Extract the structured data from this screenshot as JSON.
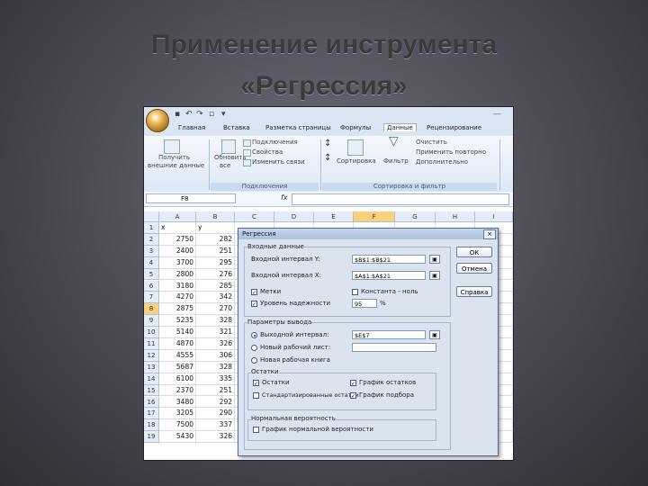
{
  "slide": {
    "title_line1": "Применение инструмента",
    "title_line2": "«Регрессия»"
  },
  "excel": {
    "tabs": [
      "Главная",
      "Вставка",
      "Разметка страницы",
      "Формулы",
      "Данные",
      "Рецензирование"
    ],
    "active_tab": "Данные",
    "ribbon": {
      "get_external_1": "Получить",
      "get_external_2": "внешние данные",
      "refresh_1": "Обновить",
      "refresh_2": "все",
      "connections": "Подключения",
      "properties": "Свойства",
      "edit_links": "Изменить связи",
      "sort": "Сортировка",
      "filter": "Фильтр",
      "clear": "Очистить",
      "reapply": "Применить повторно",
      "advanced": "Дополнительно",
      "group_connections": "Подключения",
      "group_sort_filter": "Сортировка и фильтр"
    },
    "name_box": "F8",
    "fx": "fx",
    "columns": [
      "A",
      "B",
      "C",
      "D",
      "E",
      "F",
      "G",
      "H",
      "I"
    ],
    "rows": [
      [
        "x",
        "y"
      ],
      [
        "2750",
        "282"
      ],
      [
        "2400",
        "251"
      ],
      [
        "3700",
        "295"
      ],
      [
        "2800",
        "276"
      ],
      [
        "3180",
        "285"
      ],
      [
        "4270",
        "342"
      ],
      [
        "2875",
        "270"
      ],
      [
        "5235",
        "328"
      ],
      [
        "5140",
        "321"
      ],
      [
        "4870",
        "326"
      ],
      [
        "4555",
        "306"
      ],
      [
        "5687",
        "328"
      ],
      [
        "6100",
        "335"
      ],
      [
        "2370",
        "251"
      ],
      [
        "3480",
        "292"
      ],
      [
        "3205",
        "290"
      ],
      [
        "7500",
        "337"
      ],
      [
        "5430",
        "326"
      ]
    ]
  },
  "dialog": {
    "title": "Регрессия",
    "close": "×",
    "input_section": "Входные данные",
    "input_y_label": "Входной интервал Y:",
    "input_y_value": "$B$1:$B$21",
    "input_x_label": "Входной интервал X:",
    "input_x_value": "$A$1:$A$21",
    "labels_cb": "Метки",
    "constant_zero_cb": "Константа - ноль",
    "confidence_cb": "Уровень надежности",
    "confidence_value": "95",
    "percent": "%",
    "output_section": "Параметры вывода",
    "output_range": "Выходной интервал:",
    "output_range_value": "$E$7",
    "new_sheet": "Новый рабочий лист:",
    "new_workbook": "Новая рабочая книга",
    "residuals_section": "Остатки",
    "residuals": "Остатки",
    "residual_plots": "График остатков",
    "std_residuals": "Стандартизированные остатки",
    "line_fit": "График подбора",
    "normal_section": "Нормальная вероятность",
    "normal_plot": "График нормальной вероятности",
    "ok": "ОК",
    "cancel": "Отмена",
    "help": "Справка"
  }
}
